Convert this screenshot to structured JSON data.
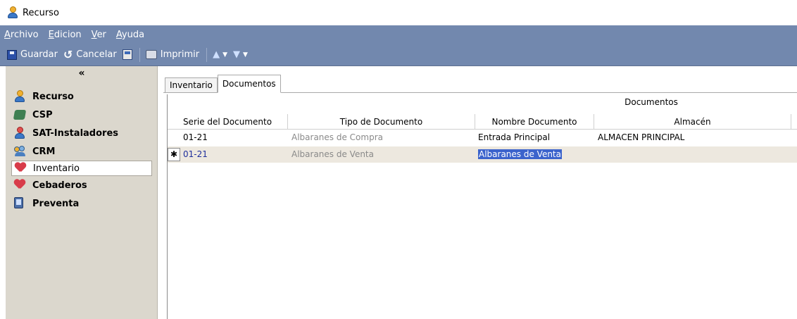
{
  "window": {
    "title": "Recurso"
  },
  "menu": [
    "Archivo",
    "Edicion",
    "Ver",
    "Ayuda"
  ],
  "toolbar": {
    "save": "Guardar",
    "cancel": "Cancelar",
    "print": "Imprimir"
  },
  "sidebar": {
    "collapse": "«",
    "items": [
      {
        "label": "Recurso",
        "icon": "person-icon"
      },
      {
        "label": "CSP",
        "icon": "csp-icon"
      },
      {
        "label": "SAT-Instaladores",
        "icon": "technician-icon"
      },
      {
        "label": "CRM",
        "icon": "users-icon"
      },
      {
        "label": "Inventario",
        "icon": "heart-box-icon"
      },
      {
        "label": "Cebaderos",
        "icon": "heart-box-icon"
      },
      {
        "label": "Preventa",
        "icon": "handheld-device-icon"
      }
    ]
  },
  "tabs": [
    "Inventario",
    "Documentos"
  ],
  "grid": {
    "band": "Documentos",
    "columns": [
      "Serie del Documento",
      "Tipo de Documento",
      "Nombre Documento",
      "Almacén"
    ],
    "rows": [
      {
        "serie": "01-21",
        "tipo": "Albaranes de Compra",
        "nombre": "Entrada Principal",
        "almacen": "ALMACEN PRINCIPAL"
      },
      {
        "indicator": "✱",
        "serie": "01-21",
        "tipo": "Albaranes de Venta",
        "nombre": "Albaranes de Venta",
        "almacen": ""
      }
    ]
  },
  "colors": {
    "chrome": "#7288ae",
    "sidebar": "#dbd7cd",
    "selected_row": "#ede8df",
    "highlight": "#3b63cc"
  }
}
